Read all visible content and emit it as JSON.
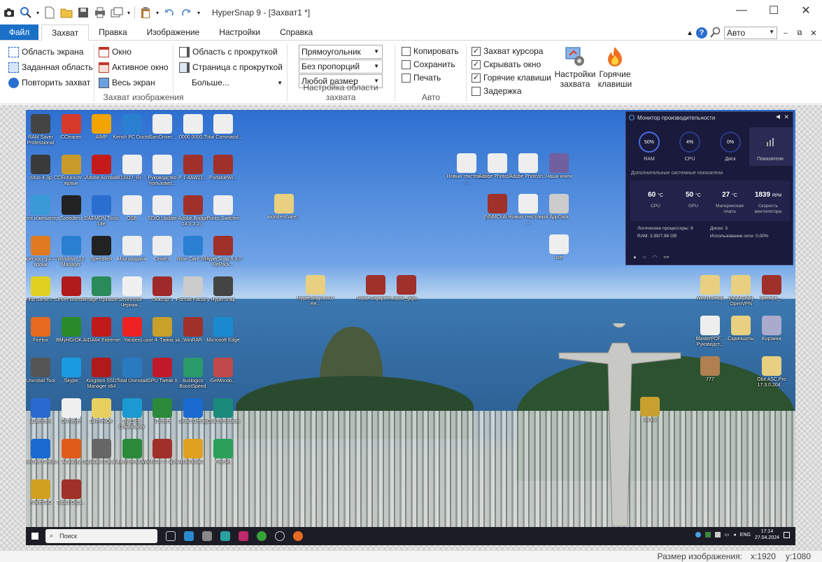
{
  "title": "HyperSnap 9 - [Захват1 *]",
  "tabs": [
    "Файл",
    "Захват",
    "Правка",
    "Изображение",
    "Настройки",
    "Справка"
  ],
  "zoom_combo": "Авто",
  "capture_group": {
    "title": "Захват изображения",
    "col1": [
      "Область экрана",
      "Заданная область",
      "Повторить захват"
    ],
    "col2": [
      "Окно",
      "Активное окно",
      "Весь экран"
    ],
    "col3": [
      "Область с прокруткой",
      "Страница с прокруткой",
      "Больше..."
    ]
  },
  "area_group": {
    "title": "Настройка области захвата",
    "combos": [
      "Прямоугольник",
      "Без пропорций",
      "Любой размер"
    ]
  },
  "auto_group": {
    "title": "Авто",
    "items": [
      {
        "label": "Копировать",
        "checked": false
      },
      {
        "label": "Сохранить",
        "checked": false
      },
      {
        "label": "Печать",
        "checked": false
      }
    ]
  },
  "opts_group": {
    "items": [
      {
        "label": "Захват курсора",
        "checked": true
      },
      {
        "label": "Скрывать окно",
        "checked": true
      },
      {
        "label": "Горячие клавиши",
        "checked": true
      },
      {
        "label": "Задержка",
        "checked": false
      }
    ],
    "btn_settings": [
      "Настройки",
      "захвата"
    ],
    "btn_hotkeys": [
      "Горячие",
      "клавиши"
    ]
  },
  "desktop_icons": [
    {
      "l": "RAM Saver Professional",
      "c": "#444"
    },
    {
      "l": "CCleaner",
      "c": "#d63a2a"
    },
    {
      "l": "AIMP",
      "c": "#f2a400"
    },
    {
      "l": "Kerish PC Doctor",
      "c": "#2a7fd0"
    },
    {
      "l": "SamDriver...",
      "c": "#eee"
    },
    {
      "l": "0000 0000...",
      "c": "#eee"
    },
    {
      "l": "Total Command...",
      "c": "#eee"
    },
    {
      "l": "rufus-4.3p",
      "c": "#3a3a3a"
    },
    {
      "l": "CCEnhancer — ярлык",
      "c": "#c89a2a"
    },
    {
      "l": "Adobe Acrobat",
      "c": "#c41a1a"
    },
    {
      "l": "813337_Ri-...",
      "c": "#eee"
    },
    {
      "l": "Руководство пользоват...",
      "c": "#eee"
    },
    {
      "l": "P 1-4AW11...",
      "c": "#a0302a"
    },
    {
      "l": "PortableWi...",
      "c": "#a0302a"
    },
    {
      "l": "Этот компьютер",
      "c": "#3a9ad6"
    },
    {
      "l": "Speedtest",
      "c": "#222"
    },
    {
      "l": "DAEMON Tools Lite",
      "c": "#2a6fd0"
    },
    {
      "l": "OSB",
      "c": "#eee"
    },
    {
      "l": "SDIO Update",
      "c": "#eee"
    },
    {
      "l": "Adobe.Bridge 14.0.2.2...",
      "c": "#a0302a"
    },
    {
      "l": "Punto Switcher",
      "c": "#eee"
    },
    {
      "l": "openvpn-gui — ярлык",
      "c": "#e07a20"
    },
    {
      "l": "Windows 10 Manager",
      "c": "#2a7fd0"
    },
    {
      "l": "Speedtest",
      "c": "#222"
    },
    {
      "l": "Мои раздачи",
      "c": "#eee"
    },
    {
      "l": "Drivers",
      "c": "#eee"
    },
    {
      "l": "Wise Care 365",
      "c": "#2a7fd0"
    },
    {
      "l": "HyperSnap 9.3.0 RePack...",
      "c": "#a0302a"
    },
    {
      "l": "Find.Same.I...",
      "c": "#e0d020"
    },
    {
      "l": "Driver Booster",
      "c": "#b01a1a"
    },
    {
      "l": "Image Uploader",
      "c": "#2a8a5a"
    },
    {
      "l": "Sevenrose - Черная ...",
      "c": "#f0f0f0"
    },
    {
      "l": "Люксор 3",
      "c": "#a02a2a"
    },
    {
      "l": "Format Factory",
      "c": "#ccc"
    },
    {
      "l": "HyperSnap",
      "c": "#444"
    },
    {
      "l": "Firefox",
      "c": "#e86a20"
    },
    {
      "l": "BMyHGrOK...",
      "c": "#2a8a2a"
    },
    {
      "l": "AIDA64 Extreme",
      "c": "#c01a1a"
    },
    {
      "l": "Yandex",
      "c": "#e22"
    },
    {
      "l": "Luxor 4: Тайна за...",
      "c": "#c8a02a"
    },
    {
      "l": "WinRAR",
      "c": "#a0302a"
    },
    {
      "l": "Microsoft Edge",
      "c": "#1a8ad0"
    },
    {
      "l": "Uninstall Tool",
      "c": "#555"
    },
    {
      "l": "Skype",
      "c": "#1a9ae0"
    },
    {
      "l": "Kingston SSD Manager x64",
      "c": "#b01a1a"
    },
    {
      "l": "Total Uninstall",
      "c": "#2a7ac0"
    },
    {
      "l": "GPU Tweak II",
      "c": "#c01a2a"
    },
    {
      "l": "Auslogics BoostSpeed",
      "c": "#2a9a6a"
    },
    {
      "l": "GetWindo...",
      "c": "#c04a4a"
    },
    {
      "l": "qBittorrent",
      "c": "#2a6ad0"
    },
    {
      "l": "OllPlayer",
      "c": "#f0f0f0"
    },
    {
      "l": "DirPrintOK",
      "c": "#e8d060"
    },
    {
      "l": "By Click Downloader",
      "c": "#1a9ad0"
    },
    {
      "l": "µTorrent",
      "c": "#2a8a3a"
    },
    {
      "l": "Smart Defrag",
      "c": "#1a6ad0"
    },
    {
      "l": "IObit Uninstaller",
      "c": "#1a8a7a"
    },
    {
      "l": "F-Secure Freedo...",
      "c": "#1a6ad0"
    },
    {
      "l": "Audacity",
      "c": "#e05a1a"
    },
    {
      "l": "Duplicate Cleaner",
      "c": "#666"
    },
    {
      "l": "Mem Reduct",
      "c": "#2a8a3a"
    },
    {
      "l": "WinRAR — ярлык",
      "c": "#a0302a"
    },
    {
      "l": "Dashboard",
      "c": "#e0a020"
    },
    {
      "l": "FReset",
      "c": "#2aa05a"
    },
    {
      "l": "PowerISO",
      "c": "#d0a020"
    },
    {
      "l": "Topaz.Giga...",
      "c": "#a0302a"
    }
  ],
  "desktop_icons_right": [
    {
      "l": "wondershare...",
      "c": "#e8d080"
    },
    {
      "l": "Новый текстовый ...",
      "c": "#eee"
    },
    {
      "l": "Adobe Photosh...",
      "c": "#eee"
    },
    {
      "l": "Adobe Photosh...",
      "c": "#eee"
    },
    {
      "l": "Наши книги",
      "c": "#7060a0"
    },
    {
      "l": "[NNMClub...",
      "c": "#a0302a"
    },
    {
      "l": "Новый текстовый ...",
      "c": "#eee"
    },
    {
      "l": "AppData",
      "c": "#ccc"
    },
    {
      "l": "user",
      "c": "#eee"
    },
    {
      "l": "HyperSnap 9.3.0 Re...",
      "c": "#e8d080"
    },
    {
      "l": "Topaz Gigapixel...",
      "c": "#a0302a"
    },
    {
      "l": "topaz_giga...",
      "c": "#a0302a"
    },
    {
      "l": "WinNTSetup",
      "c": "#e8d080"
    },
    {
      "l": "[NNMClub] OpenVPN",
      "c": "#e8d080"
    },
    {
      "l": "openvpn_...",
      "c": "#a0302a"
    },
    {
      "l": "MasterPDF... Руководст...",
      "c": "#eee"
    },
    {
      "l": "Скриншоты",
      "c": "#e8d080"
    },
    {
      "l": "Корзина",
      "c": "#aac"
    },
    {
      "l": "777",
      "c": "#b08050"
    },
    {
      "l": "Obit ASC Pro 17.3.0.204 ...",
      "c": "#e8d080"
    },
    {
      "l": "Winrar",
      "c": "#c8a030"
    }
  ],
  "perf_monitor": {
    "title": "Монитор производительности",
    "gauges": [
      {
        "val": "50%",
        "lbl": "RAM"
      },
      {
        "val": "4%",
        "lbl": "CPU"
      },
      {
        "val": "0%",
        "lbl": "Диск"
      }
    ],
    "tab_label": "Показатели",
    "extra_label": "Дополнительные системные показатели",
    "temps": [
      {
        "val": "60",
        "unit": "°C",
        "lbl": "CPU"
      },
      {
        "val": "50",
        "unit": "°C",
        "lbl": "GPU"
      },
      {
        "val": "27",
        "unit": "°C",
        "lbl": "Материнская плата"
      },
      {
        "val": "1839",
        "unit": "RPM",
        "lbl": "Скорость вентилятора"
      }
    ],
    "info1": "Логические процессоры: 8",
    "info2": "RAM: 3,99/7,98 GB",
    "info3": "Диски: 3",
    "info4": "Использование сети: 0,00%"
  },
  "taskbar": {
    "search": "Поиск",
    "lang": "ENG",
    "time": "17:14",
    "date": "27.04.2024"
  },
  "status": {
    "label": "Размер изображения:",
    "x": "x:1920",
    "y": "y:1080"
  }
}
